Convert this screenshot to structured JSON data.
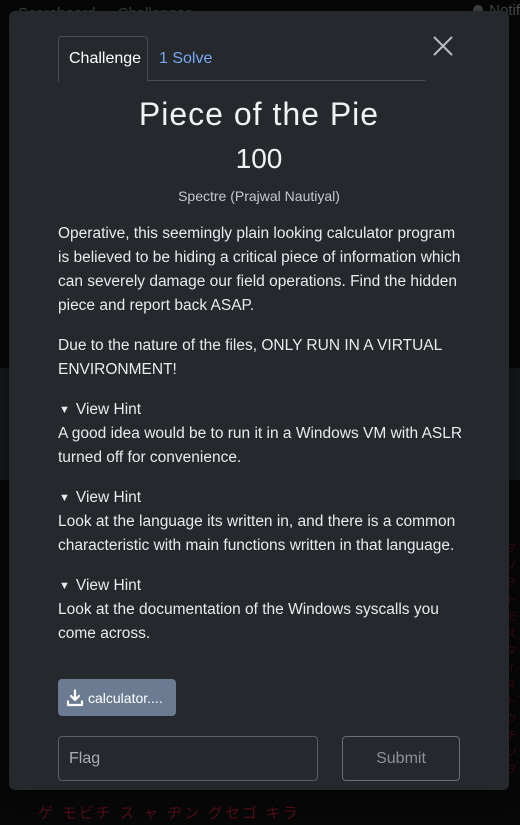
{
  "background": {
    "nav_items": [
      "Scoreboard",
      "Challenges"
    ],
    "notifications_label": "Notif",
    "matrix_text": "ゲ モビチ ス ャ ヂン グセゴ キラ",
    "side_text": "ヲ ゾ ヲ ト モ ス タ イ ヌ ト ウ チ ツ ヲ"
  },
  "modal": {
    "tabs": [
      {
        "label": "Challenge",
        "active": true
      },
      {
        "label": "1 Solve",
        "active": false
      }
    ],
    "title": "Piece of the Pie",
    "points": "100",
    "author": "Spectre (Prajwal Nautiyal)",
    "description": [
      "Operative, this seemingly plain looking calculator program is believed to be hiding a critical piece of information which can severely damage our field operations. Find the hidden piece and report back ASAP.",
      "Due to the nature of the files, ONLY RUN IN A VIRTUAL ENVIRONMENT!"
    ],
    "hints": [
      {
        "summary": "View Hint",
        "text": "A good idea would be to run it in a Windows VM with ASLR turned off for convenience."
      },
      {
        "summary": "View Hint",
        "text": "Look at the language its written in, and there is a common characteristic with main functions written in that language."
      },
      {
        "summary": "View Hint",
        "text": "Look at the documentation of the Windows syscalls you come across."
      }
    ],
    "file_label": "calculator....",
    "flag_placeholder": "Flag",
    "submit_label": "Submit"
  },
  "colors": {
    "modal_bg": "#25282c",
    "link": "#78a9f0",
    "file_button": "#6b7c92",
    "matrix": "#8b1a24"
  }
}
